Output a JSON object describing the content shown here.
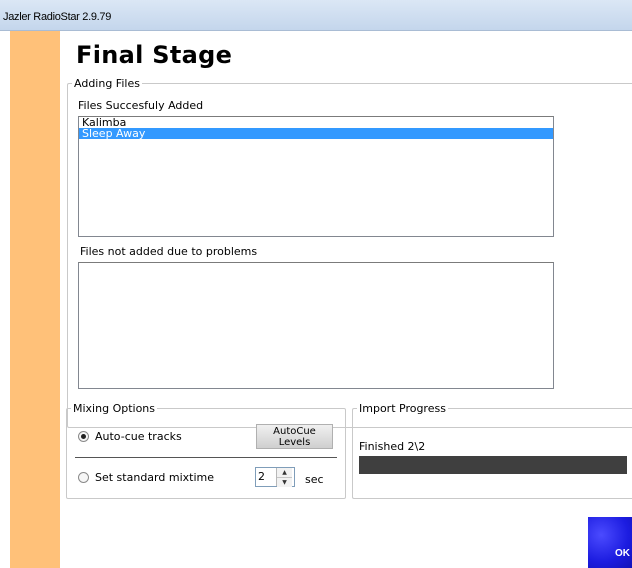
{
  "window": {
    "title": "Jazler RadioStar 2.9.79"
  },
  "page": {
    "title": "Final Stage"
  },
  "adding_files": {
    "legend": "Adding Files",
    "added_label": "Files Succesfuly Added",
    "added_items": [
      "Kalimba",
      "Sleep Away"
    ],
    "selected_index": 1,
    "failed_label": "Files not added due to problems",
    "failed_items": []
  },
  "mixing_options": {
    "legend": "Mixing Options",
    "autocue_label": "Auto-cue tracks",
    "autocue_checked": true,
    "autocue_levels_button": "AutoCue Levels",
    "standard_mixtime_label": "Set standard mixtime",
    "standard_mixtime_checked": false,
    "mixtime_value": "2",
    "mixtime_unit": "sec"
  },
  "import_progress": {
    "legend": "Import Progress",
    "status": "Finished 2\\2",
    "fraction": 1.0
  },
  "actions": {
    "ok_label": "OK"
  },
  "colors": {
    "sidebar": "#ffc179",
    "selection": "#3399ff",
    "ok_button": "#1c1ce0",
    "progress_fill": "#3f3f3f"
  }
}
